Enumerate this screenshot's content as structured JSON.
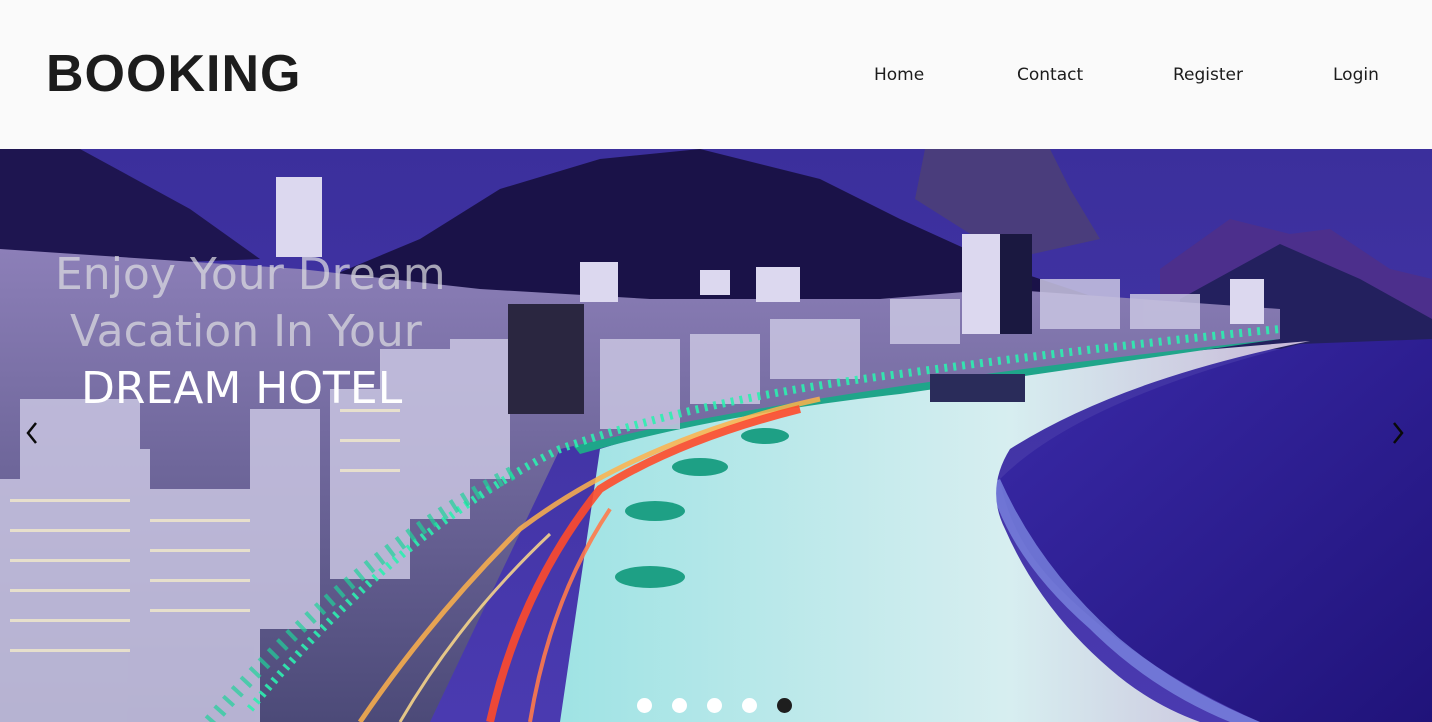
{
  "brand": {
    "logo": "BOOKING"
  },
  "nav": {
    "items": [
      "Home",
      "Contact",
      "Register",
      "Login"
    ]
  },
  "hero": {
    "caption_line1": "Enjoy Your Dream",
    "caption_line2": "Vacation In Your",
    "caption_line3": "DREAM HOTEL",
    "prev_icon": "chevron-left-icon",
    "next_icon": "chevron-right-icon",
    "slides": {
      "count": 5,
      "active": 5
    }
  },
  "colors": {
    "header_bg": "#fafafa",
    "text_dark": "#1c1c1c",
    "sky": "#3a2f9e",
    "sea": "#2c1f8a",
    "beach": "#bfe7e8",
    "lights_green": "#2cf0b0",
    "traffic_red": "#ff4a2a"
  }
}
